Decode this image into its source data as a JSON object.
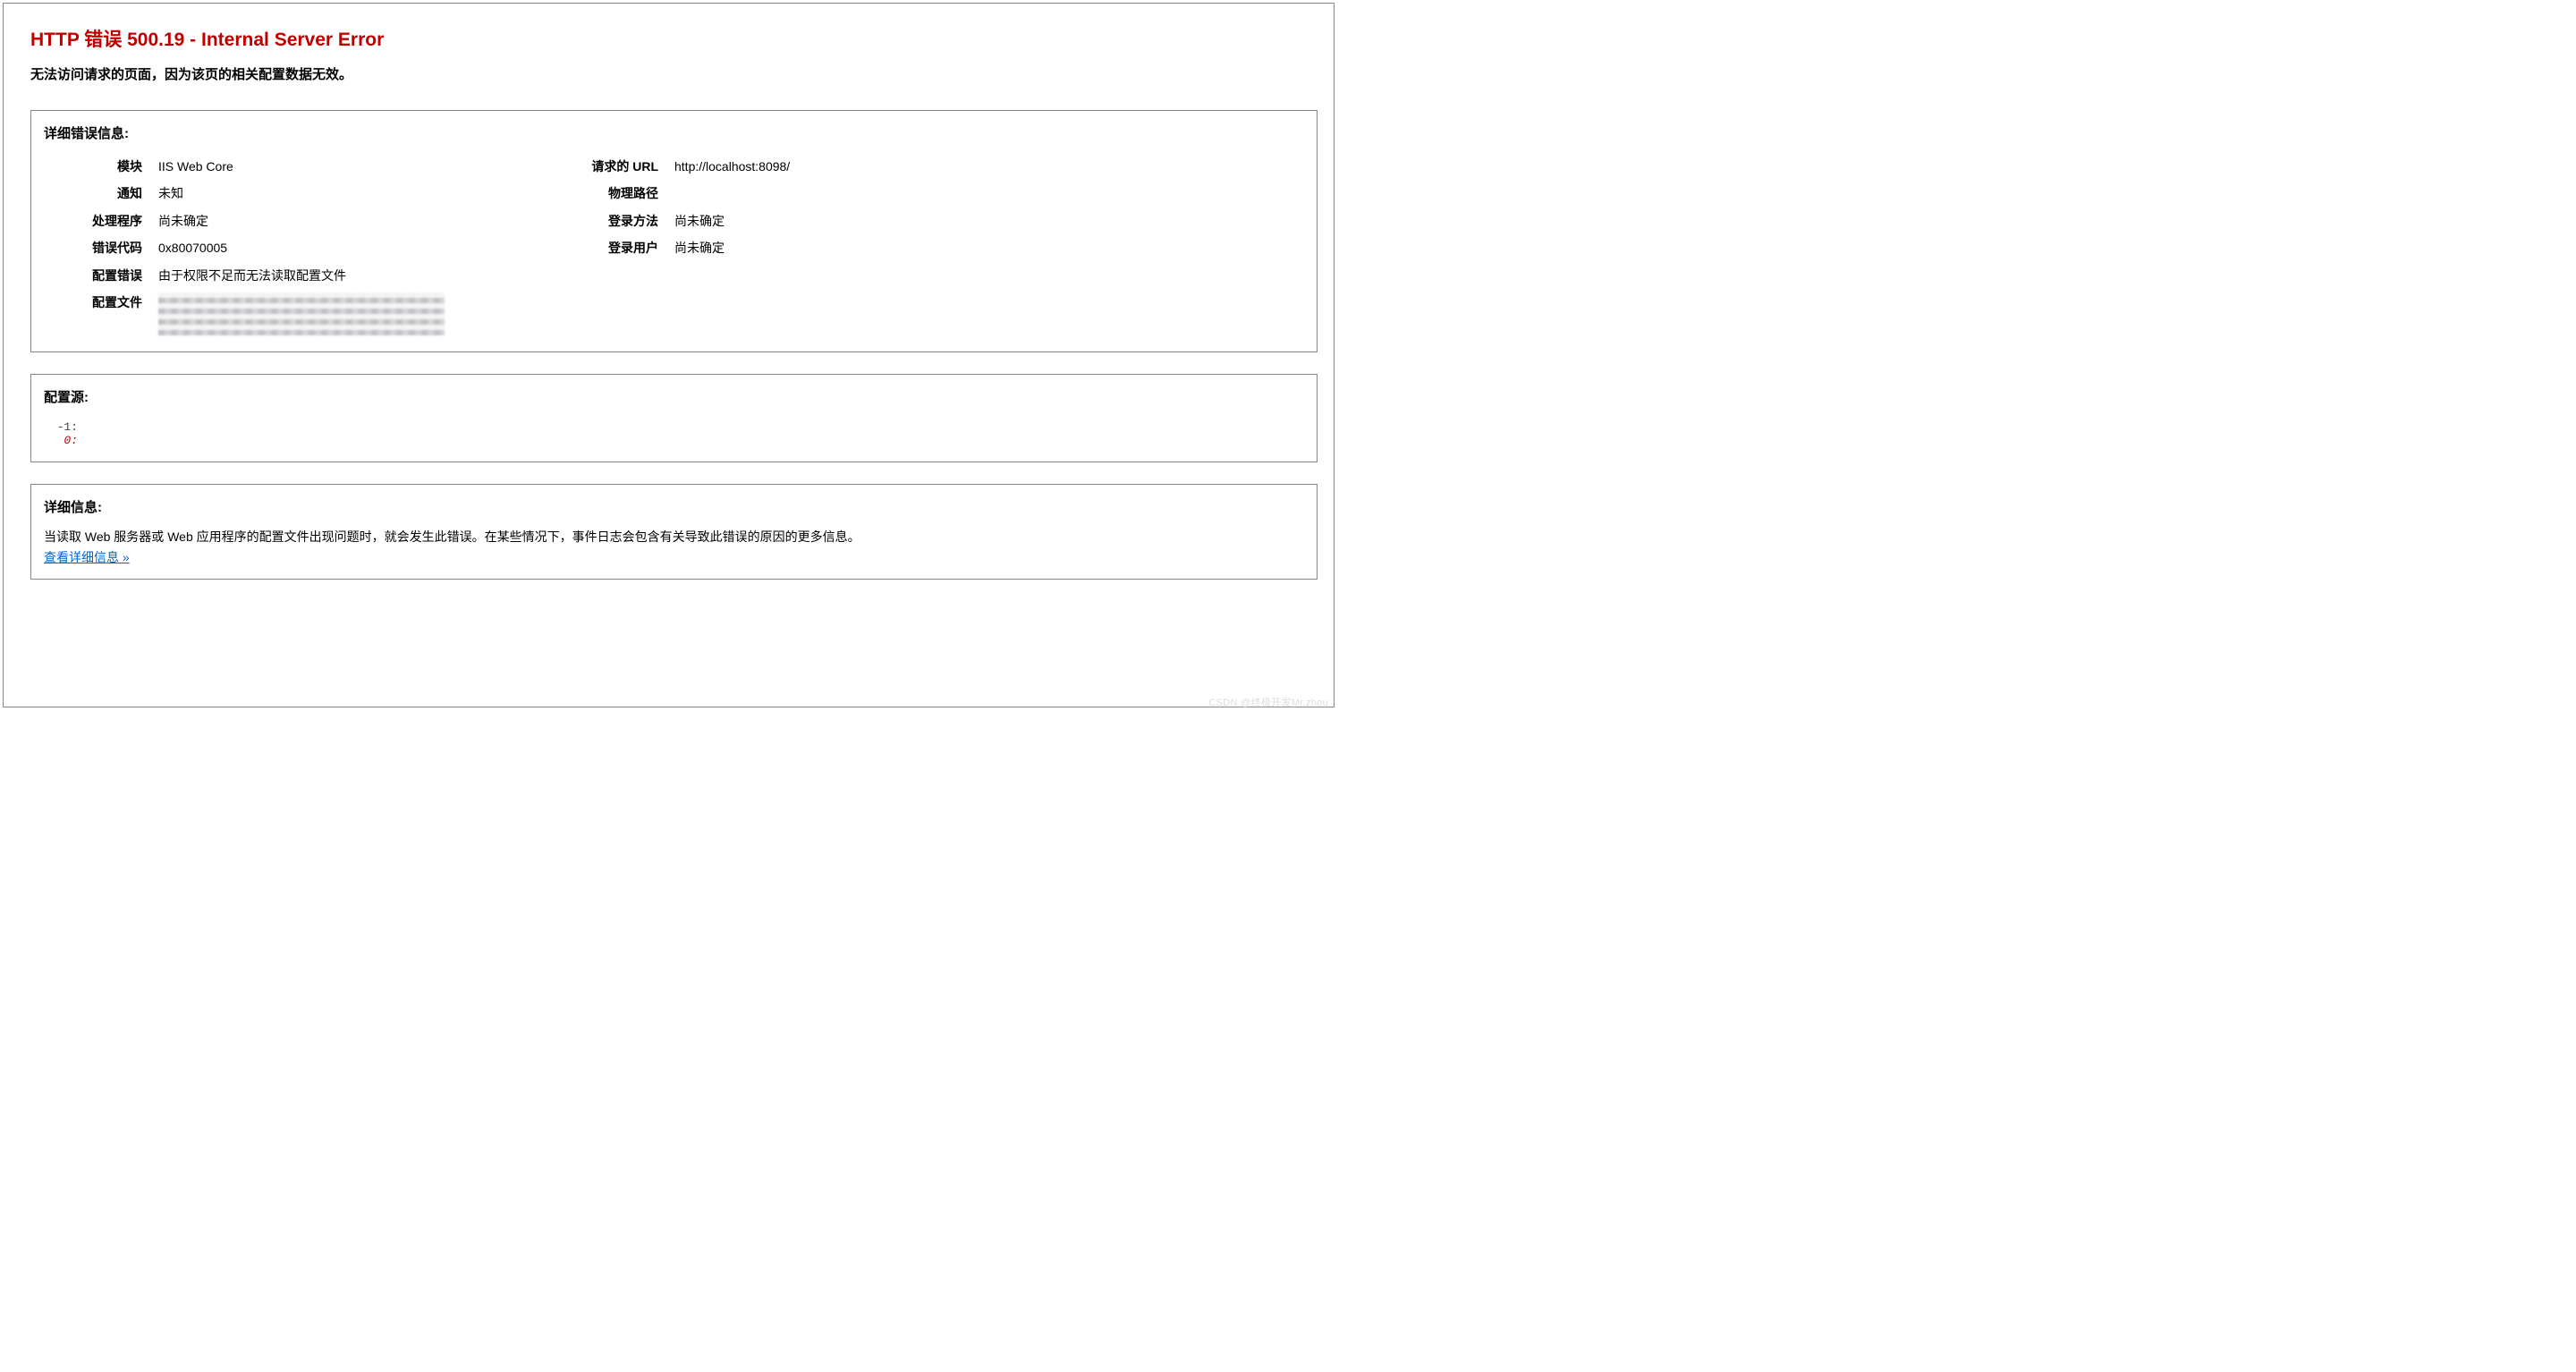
{
  "title": "HTTP 错误 500.19 - Internal Server Error",
  "subtitle": "无法访问请求的页面，因为该页的相关配置数据无效。",
  "details": {
    "heading": "详细错误信息:",
    "left": {
      "module_label": "模块",
      "module_value": "IIS Web Core",
      "notification_label": "通知",
      "notification_value": "未知",
      "handler_label": "处理程序",
      "handler_value": "尚未确定",
      "error_code_label": "错误代码",
      "error_code_value": "0x80070005",
      "config_error_label": "配置错误",
      "config_error_value": "由于权限不足而无法读取配置文件",
      "config_file_label": "配置文件"
    },
    "right": {
      "requested_url_label": "请求的 URL",
      "requested_url_value": "http://localhost:8098/",
      "physical_path_label": "物理路径",
      "physical_path_value": "",
      "logon_method_label": "登录方法",
      "logon_method_value": "尚未确定",
      "logon_user_label": "登录用户",
      "logon_user_value": "尚未确定"
    }
  },
  "config_source": {
    "heading": "配置源:",
    "line_neg1": "-1:",
    "line_0": "0:"
  },
  "more_info": {
    "heading": "详细信息:",
    "text": "当读取 Web 服务器或 Web 应用程序的配置文件出现问题时，就会发生此错误。在某些情况下，事件日志会包含有关导致此错误的原因的更多信息。",
    "link": "查看详细信息 »"
  },
  "watermark": "CSDN @终极开发Mr.zhou"
}
